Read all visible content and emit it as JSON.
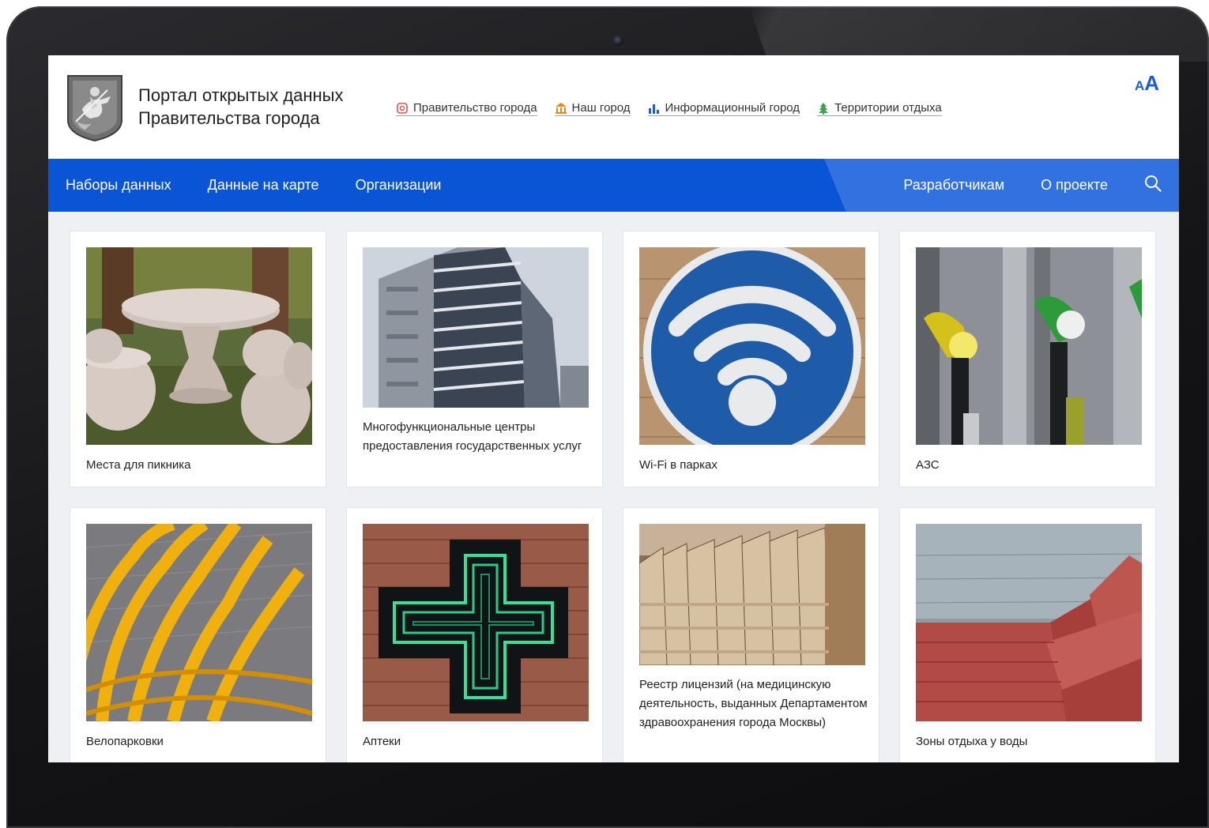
{
  "header": {
    "title_line1": "Портал открытых данных",
    "title_line2": "Правительства  города",
    "font_toggle_small": "A",
    "font_toggle_big": "A",
    "links": [
      {
        "label": "Правительство города",
        "icon": "government-icon",
        "color": "#d9534f"
      },
      {
        "label": "Наш город",
        "icon": "city-hall-icon",
        "color": "#e08a1e"
      },
      {
        "label": "Информационный город",
        "icon": "bar-chart-icon",
        "color": "#1a5dd9"
      },
      {
        "label": "Территории отдыха",
        "icon": "tree-icon",
        "color": "#3aa34a"
      }
    ]
  },
  "nav": {
    "left": [
      "Наборы данных",
      "Данные на карте",
      "Организации"
    ],
    "right": [
      "Разработчикам",
      "О проекте"
    ],
    "search_icon": "search-icon"
  },
  "cards": [
    {
      "caption": "Места для пикника",
      "image": "stone-picnic-table"
    },
    {
      "caption": "Многофункциональные центры предоставления государственных услуг",
      "image": "office-building"
    },
    {
      "caption": "Wi-Fi в парках",
      "image": "wifi-sign"
    },
    {
      "caption": "АЗС",
      "image": "fuel-nozzles"
    },
    {
      "caption": "Велопарковки",
      "image": "yellow-bike-racks"
    },
    {
      "caption": "Аптеки",
      "image": "pharmacy-neon-cross"
    },
    {
      "caption": "Реестр лицензий (на медицинскую деятельность, выданных Департаментом здравоохранения города Москвы)",
      "image": "paper-files"
    },
    {
      "caption": "Зоны отдыха у воды",
      "image": "waterfront-bench"
    }
  ],
  "colors": {
    "nav_blue": "#0a54d6",
    "nav_blue_light": "#3271e0",
    "accent": "#1a5dd9"
  }
}
